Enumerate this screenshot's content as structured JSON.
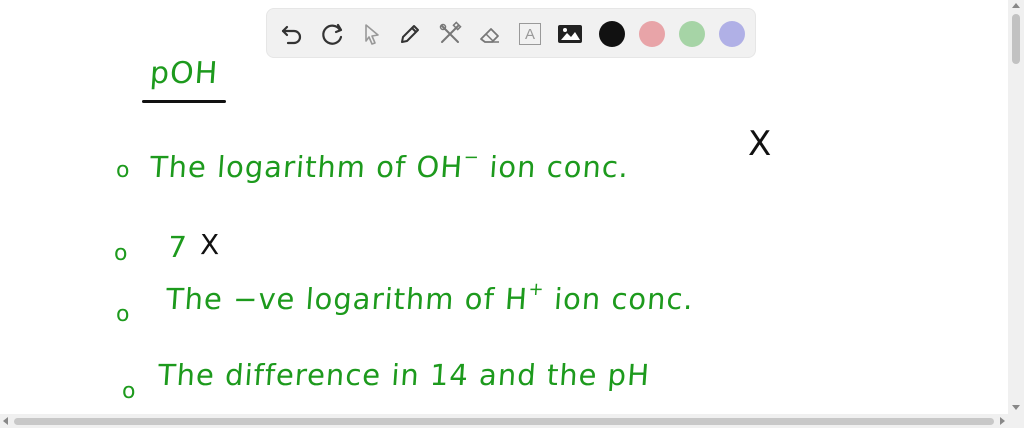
{
  "toolbar": {
    "tools": [
      {
        "name": "undo-icon"
      },
      {
        "name": "redo-icon"
      },
      {
        "name": "pointer-icon"
      },
      {
        "name": "pen-icon"
      },
      {
        "name": "tools-icon"
      },
      {
        "name": "eraser-icon"
      },
      {
        "name": "text-icon",
        "glyph": "A"
      },
      {
        "name": "image-icon"
      }
    ],
    "colors": [
      "#111111",
      "#e8a4a8",
      "#a6d4a6",
      "#b0b0e6"
    ]
  },
  "note": {
    "title": "pOH",
    "lines": [
      {
        "bullet": "o",
        "text": "The logarithm of OH",
        "sup": "−",
        "tail": " ion conc.",
        "mark": "X"
      },
      {
        "bullet": "o",
        "text": "7",
        "mark": "X"
      },
      {
        "bullet": "o",
        "text": "The −ve logarithm of H",
        "sup": "+",
        "tail": " ion conc."
      },
      {
        "bullet": "o",
        "text": "The difference in 14 and the pH"
      }
    ]
  }
}
